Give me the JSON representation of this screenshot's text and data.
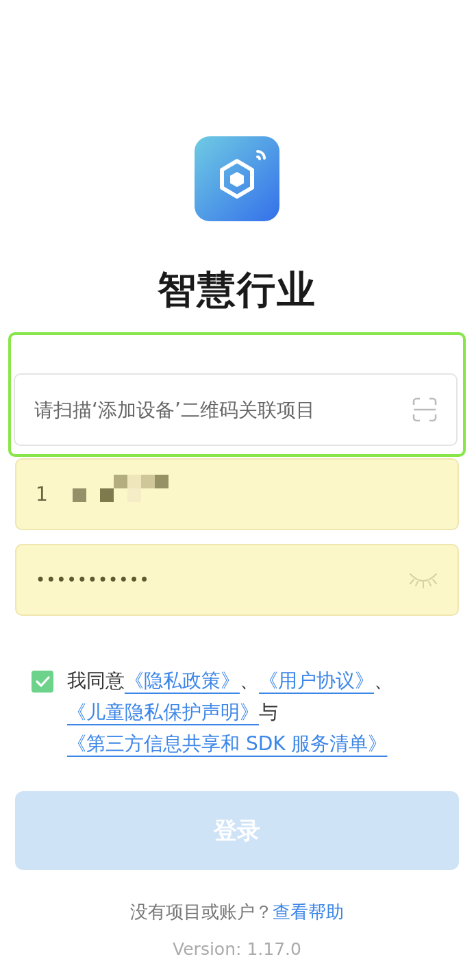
{
  "app": {
    "name": "智慧行业"
  },
  "project_field": {
    "placeholder": "请扫描‘添加设备’二维码关联项目",
    "highlighted": true
  },
  "phone_field": {
    "value": "1",
    "redacted": true
  },
  "password_field": {
    "value": "•••••••••••"
  },
  "agreement": {
    "checked": true,
    "parts": [
      {
        "kind": "text",
        "text": "我同意"
      },
      {
        "kind": "link",
        "text": "《隐私政策》"
      },
      {
        "kind": "text",
        "text": "、"
      },
      {
        "kind": "link",
        "text": "《用户协议》"
      },
      {
        "kind": "text",
        "text": "、"
      },
      {
        "kind": "link",
        "text": "《儿童隐私保护声明》"
      },
      {
        "kind": "text",
        "text": "与"
      },
      {
        "kind": "link",
        "text": "《第三方信息共享和 SDK 服务清单》"
      }
    ]
  },
  "login_button": {
    "label": "登录",
    "disabled": true
  },
  "help": {
    "prompt": "没有项目或账户？",
    "link": "查看帮助"
  },
  "version": "Version: 1.17.0"
}
